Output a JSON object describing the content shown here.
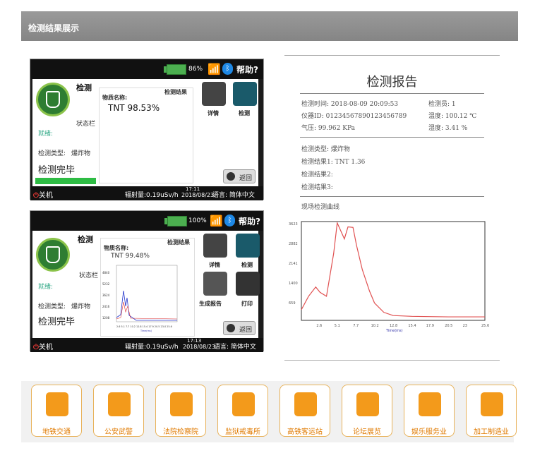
{
  "header": {
    "title": "检测结果展示"
  },
  "screen1": {
    "battery": "86%",
    "help": "帮助?",
    "title": "检测",
    "status_bar": "状态栏",
    "ready": "就绪:",
    "type_label": "检测类型:",
    "type_value": "爆炸物",
    "state": "检测完毕",
    "substance_label": "物质名称:",
    "result_header": "检测结果",
    "result": "TNT 98.53%",
    "btn_detail": "详情",
    "btn_detect": "检测",
    "return": "返回",
    "power": "关机",
    "radiation": "辐射量:0.19uSv/h",
    "time": "17:11",
    "date": "2018/08/23",
    "lang": "语言: 简体中文"
  },
  "screen2": {
    "battery": "100%",
    "help": "帮助?",
    "title": "检测",
    "status_bar": "状态栏",
    "ready": "就绪:",
    "type_label": "检测类型:",
    "type_value": "爆炸物",
    "state": "检测完毕",
    "substance_label": "物质名称:",
    "result_header": "检测结果",
    "result": "TNT 99.48%",
    "btn_detail": "详情",
    "btn_detect": "检测",
    "btn_report": "生成报告",
    "btn_print": "打印",
    "return": "返回",
    "power": "关机",
    "radiation": "辐射量:0.19uSv/h",
    "time": "17:13",
    "date": "2018/08/23",
    "lang": "语言: 简体中文",
    "chart_yticks": [
      "4840",
      "5232",
      "3624",
      "2416",
      "1208"
    ],
    "chart_xticks": "2.6 5.1 7.7 10.2 12.8 15.4 17.9 20.5 23.0 25.6",
    "chart_xlabel": "Time(ms)"
  },
  "report": {
    "title": "检测报告",
    "time": "检测时间: 2018-08-09 20:09:53",
    "operator": "检测员: 1",
    "device": "仪器ID: 01234567890123456789",
    "temp": "温度: 100.12 ℃",
    "pressure": "气压: 99.962 KPa",
    "humidity": "湿度: 3.41 %",
    "type": "检测类型: 爆炸物",
    "r1": "检测结果1: TNT 1.36",
    "r2": "检测结果2:",
    "r3": "检测结果3:",
    "curve_label": "现场检测曲线"
  },
  "chart_data": {
    "type": "line",
    "xlabel": "Time(ms)",
    "x": [
      0,
      1.0,
      2.0,
      2.6,
      3.5,
      4.5,
      5.0,
      5.5,
      6.0,
      6.5,
      7.2,
      7.7,
      8.5,
      9.5,
      10.2,
      11.5,
      12.8,
      15.4,
      17.9,
      20.5,
      23.0,
      25.6
    ],
    "y": [
      400,
      900,
      1250,
      1050,
      900,
      2500,
      3650,
      3350,
      3050,
      3500,
      3480,
      2800,
      1900,
      1100,
      650,
      300,
      180,
      150,
      140,
      130,
      130,
      130
    ],
    "yticks": [
      3623,
      2882,
      2141,
      1400,
      659
    ],
    "xticks": [
      2.6,
      5.1,
      7.7,
      10.2,
      12.8,
      15.4,
      17.9,
      20.5,
      23.0,
      25.6
    ],
    "xlim": [
      0,
      25.6
    ],
    "ylim": [
      0,
      3700
    ],
    "color": "#e05050"
  },
  "industries": [
    "地铁交通",
    "公安武警",
    "法院检察院",
    "监狱戒毒所",
    "高铁客运站",
    "论坛展览",
    "娱乐服务业",
    "加工制造业"
  ]
}
